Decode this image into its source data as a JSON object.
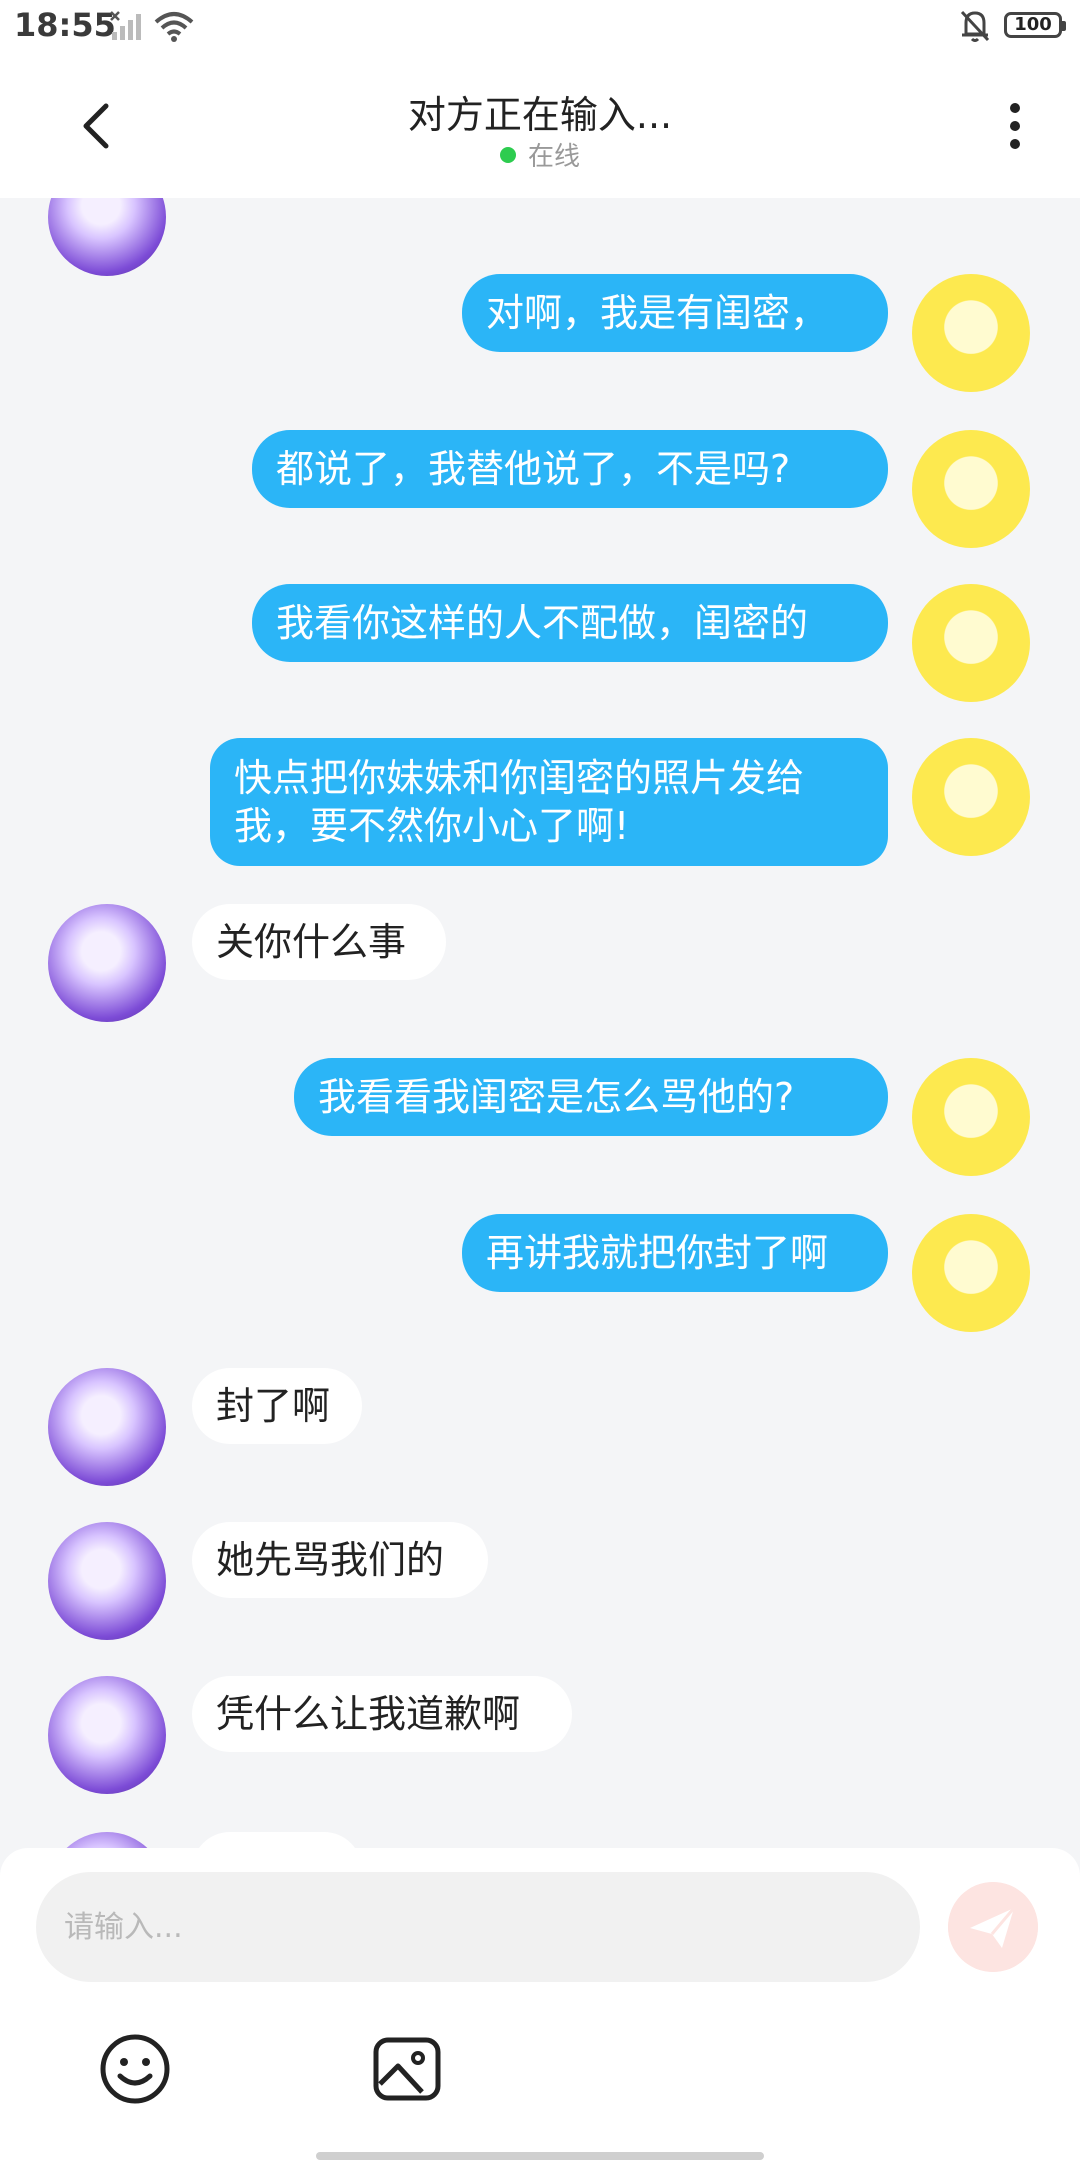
{
  "status_bar": {
    "time": "18:55",
    "battery": "100",
    "icons": [
      "signal-icon",
      "wifi-icon",
      "mute-bell-icon",
      "battery-icon"
    ]
  },
  "header": {
    "title": "对方正在输入...",
    "status": "在线",
    "status_color": "#2dcc4f"
  },
  "messages": [
    {
      "side": "out",
      "text": "对啊，我是有闺密，"
    },
    {
      "side": "out",
      "text": "都说了，我替他说了，不是吗?"
    },
    {
      "side": "out",
      "text": "我看你这样的人不配做，闺密的"
    },
    {
      "side": "out",
      "text_line1": "快点把你妹妹和你闺密的照片发给",
      "text_line2": "我，要不然你小心了啊!"
    },
    {
      "side": "in",
      "text": "关你什么事"
    },
    {
      "side": "out",
      "text": "我看看我闺密是怎么骂他的?"
    },
    {
      "side": "out",
      "text": "再讲我就把你封了啊"
    },
    {
      "side": "in",
      "text": "封了啊"
    },
    {
      "side": "in",
      "text": "她先骂我们的"
    },
    {
      "side": "in",
      "text": "凭什么让我道歉啊"
    }
  ],
  "composer": {
    "placeholder": "请输入...",
    "send_color": "#fde4e1",
    "tools": [
      "emoji-icon",
      "image-icon"
    ]
  },
  "colors": {
    "outgoing_bubble": "#2bb5f7",
    "incoming_bubble": "#ffffff",
    "background": "#f4f5f7"
  }
}
